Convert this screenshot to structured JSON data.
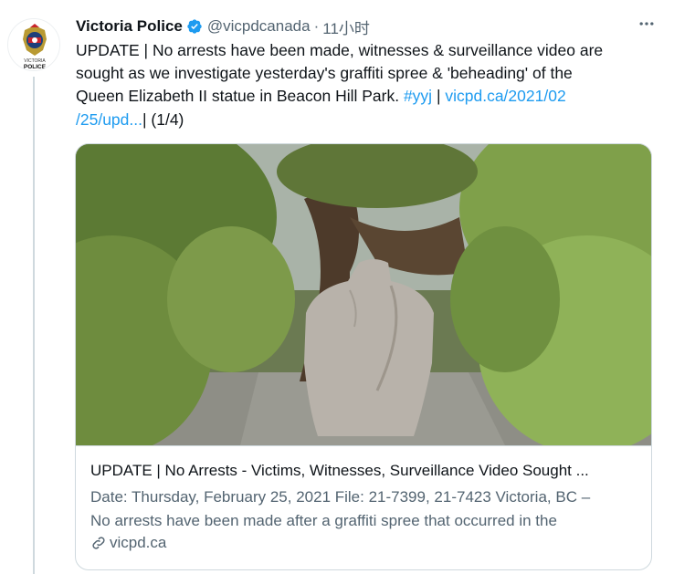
{
  "tweet": {
    "author_name": "Victoria Police",
    "handle": "@vicpdcanada",
    "separator": "·",
    "time": "11小时",
    "text_lines": [
      {
        "plain": "UPDATE | No arrests have been made, witnesses & surveillance video are"
      },
      {
        "plain": "sought as we investigate yesterday's graffiti spree & 'beheading' of the"
      },
      {
        "plain": "Queen Elizabeth II statue in Beacon Hill Park. ",
        "hashtag": "#yyj",
        "sep": " | ",
        "url_part1": "vicpd.ca/2021/02"
      },
      {
        "url_part2": "/25/upd...",
        "tail": "| (1/4)"
      }
    ],
    "avatar_badge_lines": [
      "VICTORIA",
      "POLICE"
    ]
  },
  "card": {
    "title": "UPDATE | No Arrests - Victims, Witnesses, Surveillance Video Sought ...",
    "description_lines": [
      "Date: Thursday, February 25, 2021 File: 21-7399, 21-7423 Victoria, BC –",
      "No arrests have been made after a graffiti spree that occurred in the"
    ],
    "domain": "vicpd.ca"
  },
  "colors": {
    "link": "#1d9bf0",
    "verified": "#1d9bf0",
    "secondary_text": "#536471",
    "border": "#cfd9de"
  },
  "icons": {
    "verified": "verified-badge-icon",
    "more": "more-options-icon",
    "link": "link-icon"
  }
}
